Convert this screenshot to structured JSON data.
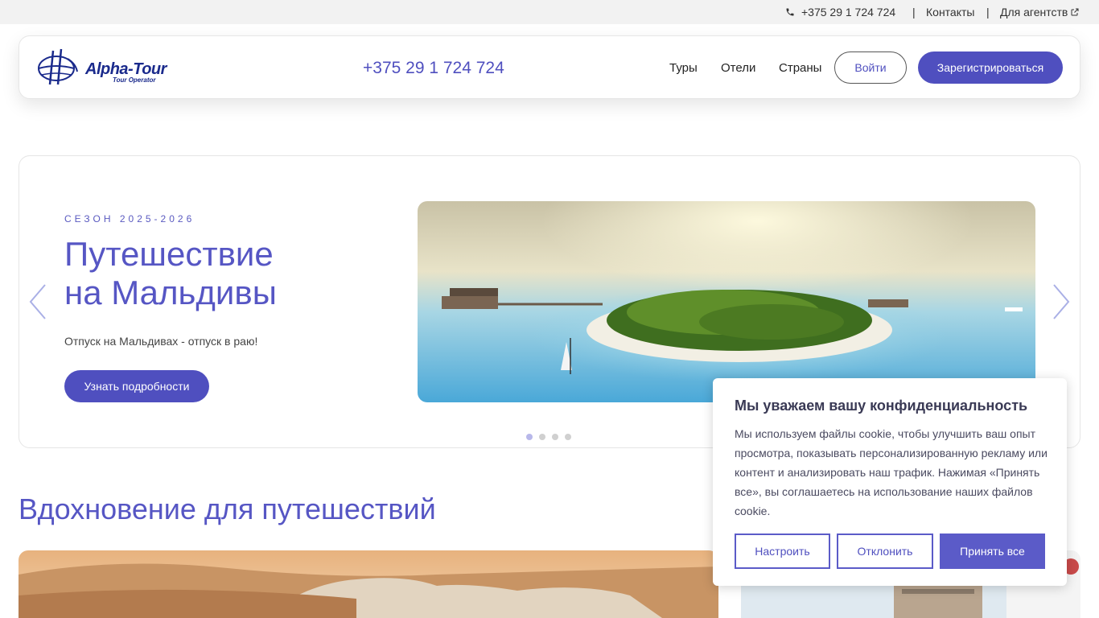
{
  "topbar": {
    "phone": "+375 29 1 724 724",
    "separator": "|",
    "contacts": "Контакты",
    "agencies": "Для агентств"
  },
  "header": {
    "logo_text": "Alpha-Tour",
    "logo_sub": "Tour Operator",
    "phone": "+375 29 1 724 724",
    "nav": [
      "Туры",
      "Отели",
      "Страны"
    ],
    "login": "Войти",
    "register": "Зарегистрироваться"
  },
  "hero": {
    "season": "СЕЗОН 2025-2026",
    "title_line1": "Путешествие",
    "title_line2": "на Мальдивы",
    "subtitle": "Отпуск на Мальдивах - отпуск в раю!",
    "cta": "Узнать подробности",
    "slide_count": 4,
    "active_slide": 1
  },
  "section": {
    "title": "Вдохновение для путешествий"
  },
  "cookie": {
    "title": "Мы уважаем вашу конфиденциальность",
    "text": "Мы используем файлы cookie, чтобы улучшить ваш опыт просмотра, показывать персонализированную рекламу или контент и анализировать наш трафик. Нажимая «Принять все», вы соглашаетесь на использование наших файлов cookie.",
    "customize": "Настроить",
    "reject": "Отклонить",
    "accept": "Принять все"
  },
  "colors": {
    "accent": "#4f4fbf",
    "heading": "#5656c4"
  }
}
